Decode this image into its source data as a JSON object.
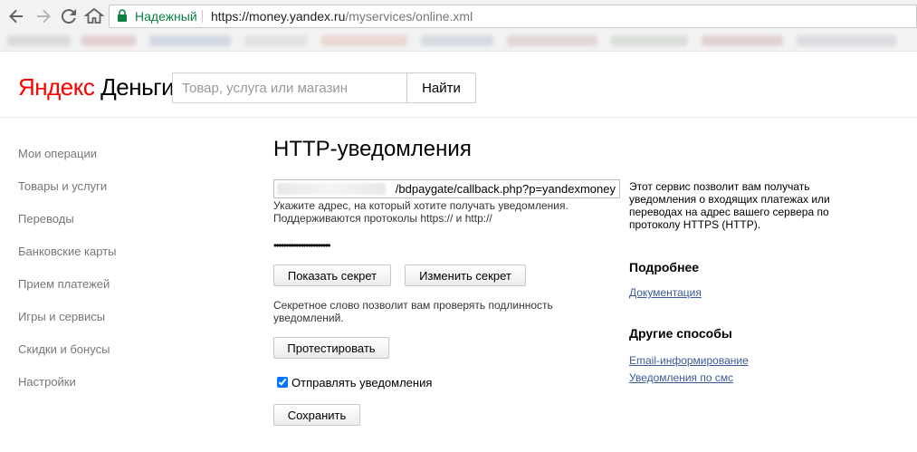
{
  "browser": {
    "secure_label": "Надежный",
    "url_host": "https://money.yandex.ru",
    "url_path": "/myservices/online.xml"
  },
  "header": {
    "logo_brand": "Яндекс",
    "logo_product": "Деньги",
    "search_placeholder": "Товар, услуга или магазин",
    "search_button": "Найти"
  },
  "sidebar": {
    "items": [
      {
        "label": "Мои операции"
      },
      {
        "label": "Товары и услуги"
      },
      {
        "label": "Переводы"
      },
      {
        "label": "Банковские карты"
      },
      {
        "label": "Прием платежей"
      },
      {
        "label": "Игры и сервисы"
      },
      {
        "label": "Скидки и бонусы"
      },
      {
        "label": "Настройки"
      }
    ]
  },
  "main": {
    "title": "HTTP-уведомления",
    "url_value": "/bdpaygate/callback.php?p=yandexmoney",
    "url_hint": "Укажите адрес, на который хотите получать уведомления. Поддерживаются протоколы https:// и http://",
    "secret_masked": "•••••••••••••••••••••••",
    "show_secret": "Показать секрет",
    "change_secret": "Изменить секрет",
    "secret_hint": "Секретное слово позволит вам проверять подлинность уведомлений.",
    "test_button": "Протестировать",
    "send_notifications": "Отправлять уведомления",
    "save_button": "Сохранить"
  },
  "right": {
    "info": "Этот сервис позволит вам получать уведомления о входящих платежах или переводах на адрес вашего сервера по протоколу HTTPS (HTTP).",
    "more_heading": "Подробнее",
    "docs_link": "Документация",
    "other_heading": "Другие способы",
    "email_link": "Email-информирование",
    "sms_link": "Уведомления по смс"
  },
  "colors": {
    "logo_red": "#ff0000",
    "secure_green": "#0b8043",
    "link": "#3b5998",
    "sidebar_text": "#777777"
  }
}
